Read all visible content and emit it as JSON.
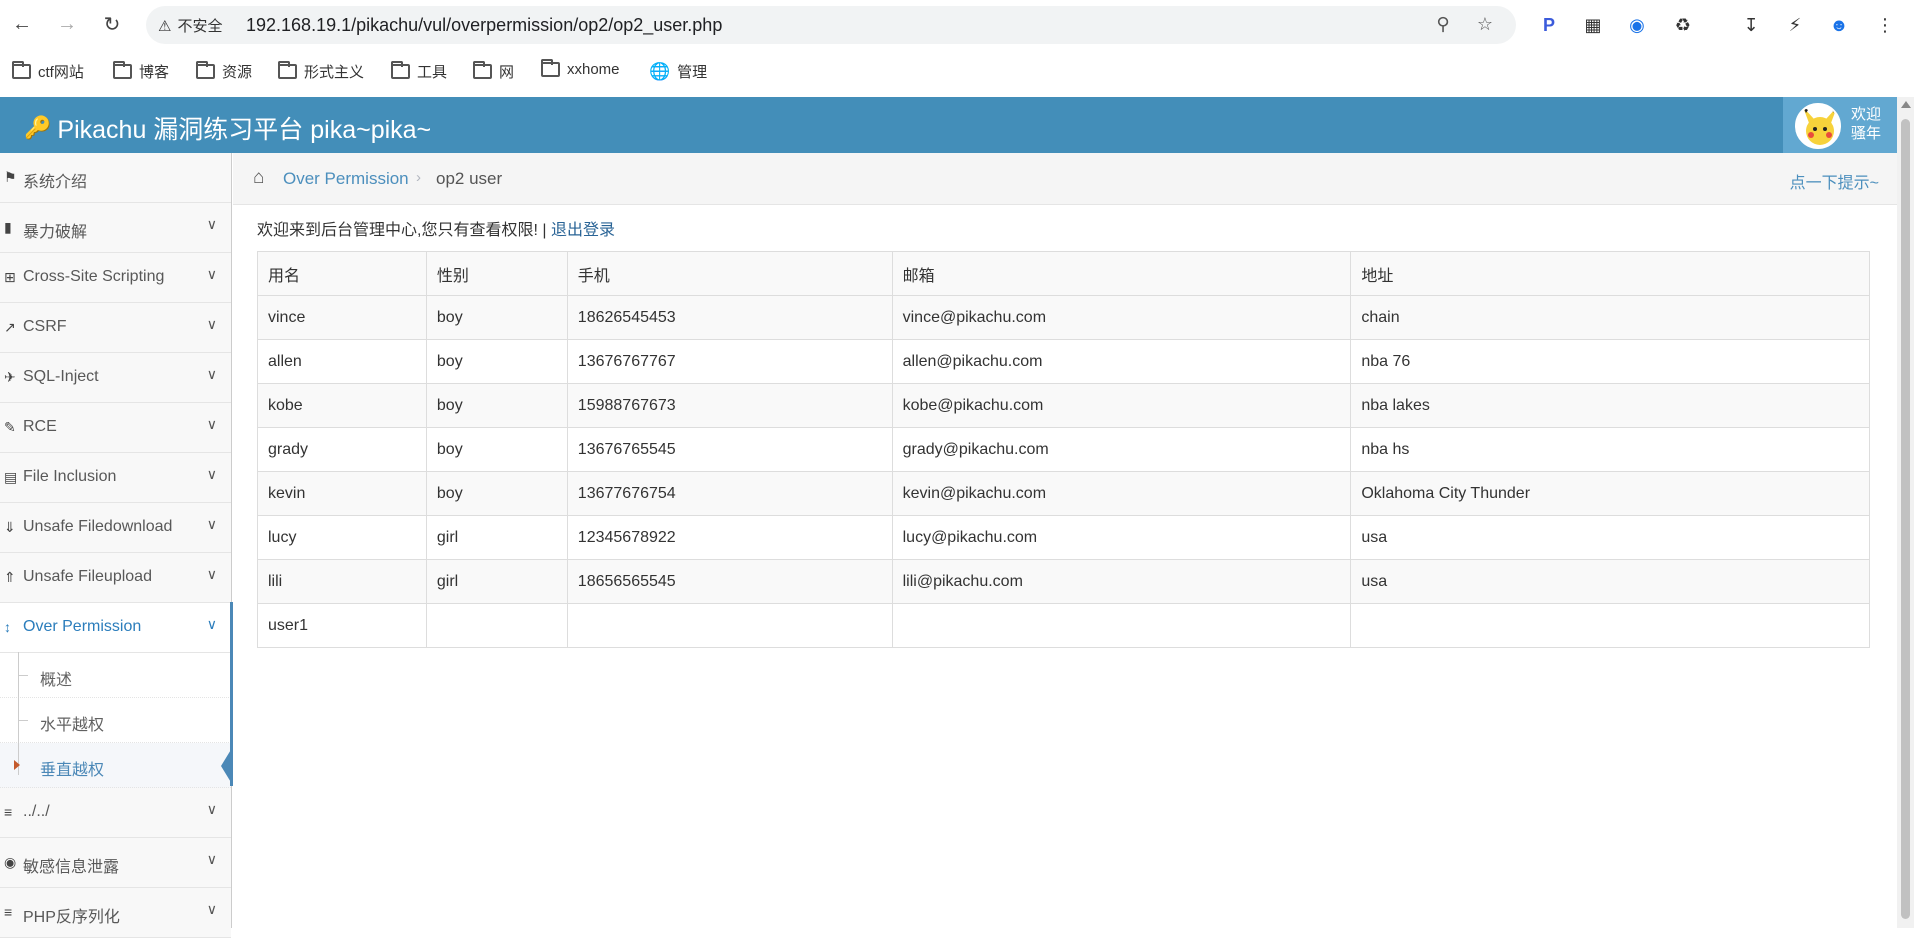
{
  "browser": {
    "insecure_label": "不安全",
    "url": "192.168.19.1/pikachu/vul/overpermission/op2/op2_user.php",
    "bookmarks": [
      "ctf网站",
      "博客",
      "资源",
      "形式主义",
      "工具",
      "网",
      "xxhome",
      "管理"
    ]
  },
  "header": {
    "title": "Pikachu 漏洞练习平台 pika~pika~",
    "user_line1": "欢迎",
    "user_line2": "骚年",
    "accent": "#438eb9"
  },
  "sidebar": {
    "items": [
      {
        "label": "系统介绍",
        "icon": "tag-icon"
      },
      {
        "label": "暴力破解",
        "icon": "lock-icon"
      },
      {
        "label": "Cross-Site Scripting",
        "icon": "sliders-icon"
      },
      {
        "label": "CSRF",
        "icon": "share-icon"
      },
      {
        "label": "SQL-Inject",
        "icon": "plane-icon"
      },
      {
        "label": "RCE",
        "icon": "pencil-icon"
      },
      {
        "label": "File Inclusion",
        "icon": "file-icon"
      },
      {
        "label": "Unsafe Filedownload",
        "icon": "download-icon"
      },
      {
        "label": "Unsafe Fileupload",
        "icon": "upload-icon"
      },
      {
        "label": "Over Permission",
        "icon": "text-height-icon"
      },
      {
        "label": "../../",
        "icon": "align-left-icon"
      },
      {
        "label": "敏感信息泄露",
        "icon": "camera-icon"
      },
      {
        "label": "PHP反序列化",
        "icon": "align-left-icon"
      }
    ],
    "subitems": [
      "概述",
      "水平越权",
      "垂直越权"
    ]
  },
  "breadcrumb": {
    "parent": "Over Permission",
    "current": "op2 user",
    "tip": "点一下提示~"
  },
  "main": {
    "welcome_text": "欢迎来到后台管理中心,您只有查看权限! |",
    "logout_label": "退出登录"
  },
  "table": {
    "headers": [
      "用名",
      "性别",
      "手机",
      "邮箱",
      "地址"
    ],
    "rows": [
      [
        "vince",
        "boy",
        "18626545453",
        "vince@pikachu.com",
        "chain"
      ],
      [
        "allen",
        "boy",
        "13676767767",
        "allen@pikachu.com",
        "nba 76"
      ],
      [
        "kobe",
        "boy",
        "15988767673",
        "kobe@pikachu.com",
        "nba lakes"
      ],
      [
        "grady",
        "boy",
        "13676765545",
        "grady@pikachu.com",
        "nba hs"
      ],
      [
        "kevin",
        "boy",
        "13677676754",
        "kevin@pikachu.com",
        "Oklahoma City Thunder"
      ],
      [
        "lucy",
        "girl",
        "12345678922",
        "lucy@pikachu.com",
        "usa"
      ],
      [
        "lili",
        "girl",
        "18656565545",
        "lili@pikachu.com",
        "usa"
      ],
      [
        "user1",
        "",
        "",
        "",
        ""
      ]
    ]
  }
}
